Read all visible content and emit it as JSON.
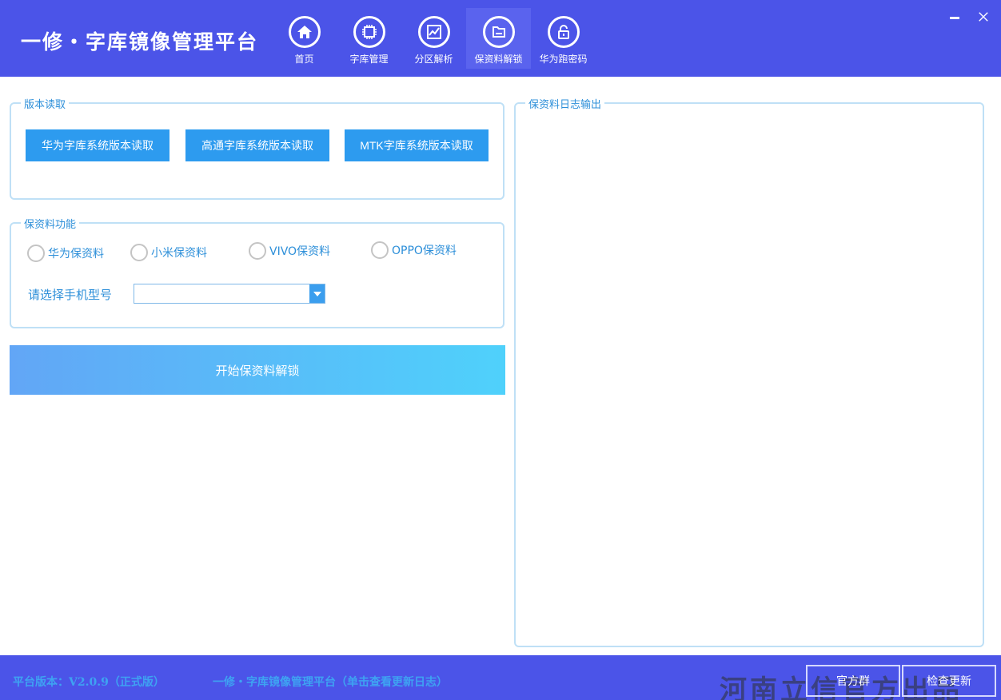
{
  "header": {
    "title": "一修・字库镜像管理平台",
    "nav": [
      {
        "label": "首页",
        "icon": "home-icon"
      },
      {
        "label": "字库管理",
        "icon": "chip-icon"
      },
      {
        "label": "分区解析",
        "icon": "chart-icon"
      },
      {
        "label": "保资料解锁",
        "icon": "folder-icon"
      },
      {
        "label": "华为跑密码",
        "icon": "lock-icon"
      }
    ],
    "active_nav": "保资料解锁",
    "minimize_label": "—",
    "close_label": "✕"
  },
  "version_group": {
    "legend": "版本读取",
    "buttons": [
      "华为字库系统版本读取",
      "高通字库系统版本读取",
      "MTK字库系统版本读取"
    ]
  },
  "function_group": {
    "legend": "保资料功能",
    "radios": [
      "华为保资料",
      "小米保资料",
      "VIVO保资料",
      "OPPO保资料"
    ],
    "model_label": "请选择手机型号",
    "model_value": ""
  },
  "start_button": "开始保资料解锁",
  "log_group": {
    "legend": "保资料日志输出"
  },
  "footer": {
    "version": "平台版本：V2.0.9（正式版）",
    "changelog": "一修・字库镜像管理平台（单击查看更新日志）",
    "watermark": "河南立信官方出品",
    "btn_group": "官方群",
    "btn_update": "检查更新"
  },
  "colors": {
    "brand": "#4b54e8",
    "accent": "#2d9bef",
    "text_blue": "#2d8fd9",
    "border": "#bfe0f6"
  }
}
